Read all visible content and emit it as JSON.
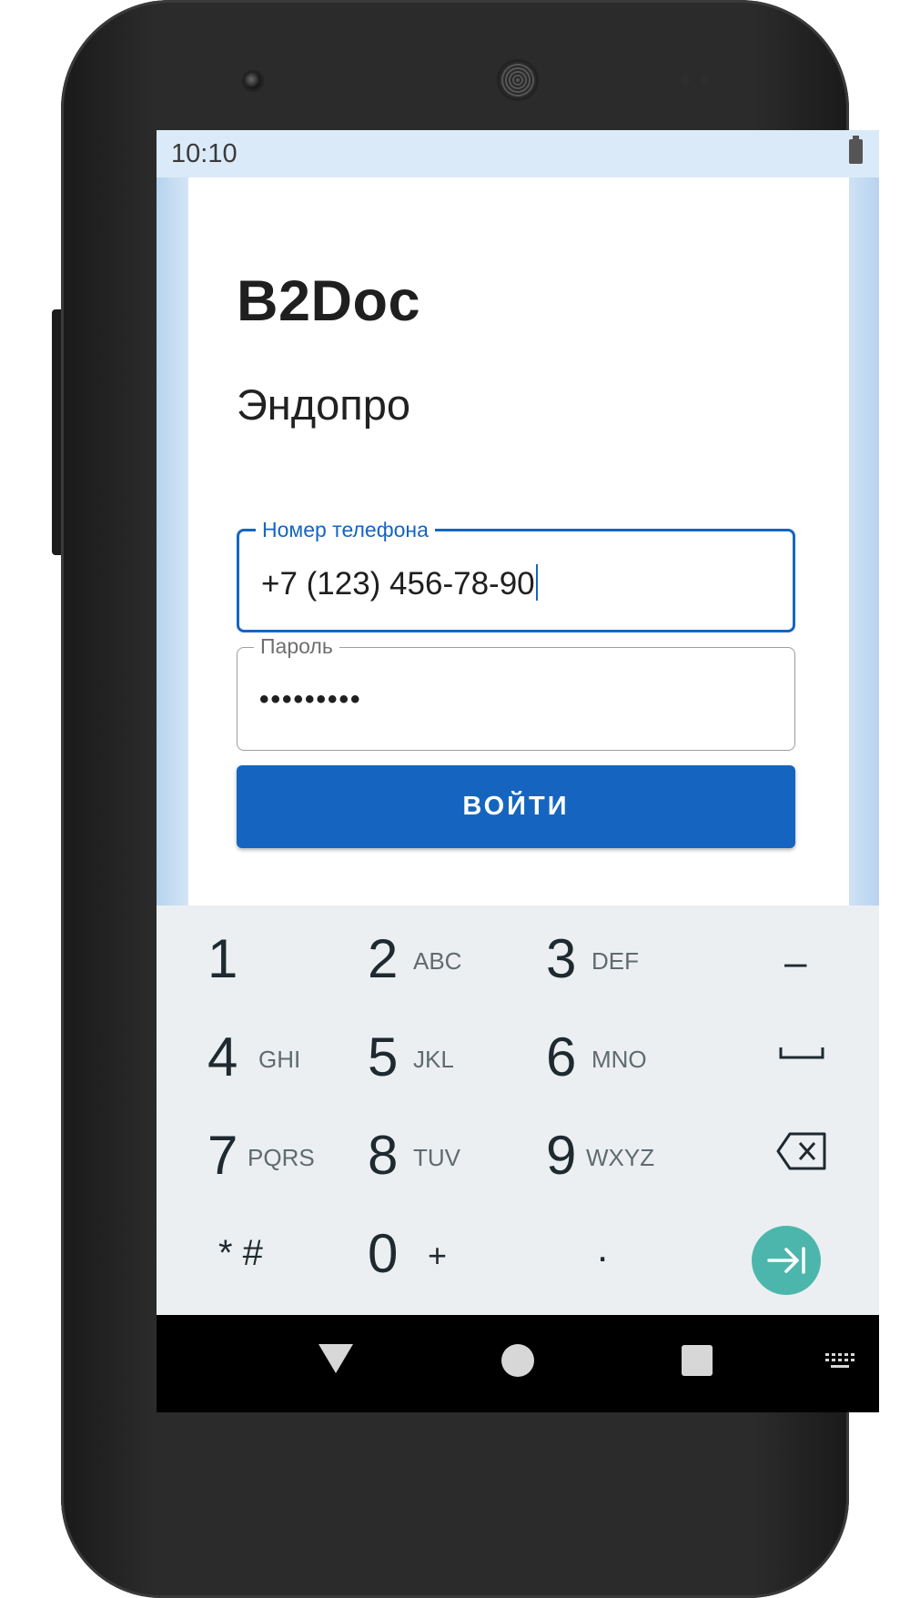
{
  "status_bar": {
    "time": "10:10"
  },
  "app": {
    "title": "B2Doc",
    "subtitle": "Эндопро",
    "phone_field": {
      "label": "Номер телефона",
      "value": "+7 (123) 456-78-90"
    },
    "password_field": {
      "label": "Пароль",
      "value": "•••••••••"
    },
    "login_button": "ВОЙТИ"
  },
  "keyboard": {
    "rows": [
      [
        {
          "digit": "1",
          "letters": ""
        },
        {
          "digit": "2",
          "letters": "ABC"
        },
        {
          "digit": "3",
          "letters": "DEF"
        },
        {
          "symbol": "–",
          "name": "minus"
        }
      ],
      [
        {
          "digit": "4",
          "letters": "GHI"
        },
        {
          "digit": "5",
          "letters": "JKL"
        },
        {
          "digit": "6",
          "letters": "MNO"
        },
        {
          "symbol": "space",
          "name": "space"
        }
      ],
      [
        {
          "digit": "7",
          "letters": "PQRS"
        },
        {
          "digit": "8",
          "letters": "TUV"
        },
        {
          "digit": "9",
          "letters": "WXYZ"
        },
        {
          "symbol": "backspace",
          "name": "backspace"
        }
      ],
      [
        {
          "symbol": "* #",
          "name": "star-hash"
        },
        {
          "digit": "0",
          "letters": "+"
        },
        {
          "symbol": ".",
          "name": "period"
        },
        {
          "symbol": "go",
          "name": "go"
        }
      ]
    ],
    "go_color": "#4db6ac"
  },
  "colors": {
    "primary": "#1565c0",
    "status_bg": "#dbeaf8"
  },
  "nav_icons": [
    "back-icon",
    "home-icon",
    "recents-icon",
    "keyboard-switch-icon"
  ]
}
